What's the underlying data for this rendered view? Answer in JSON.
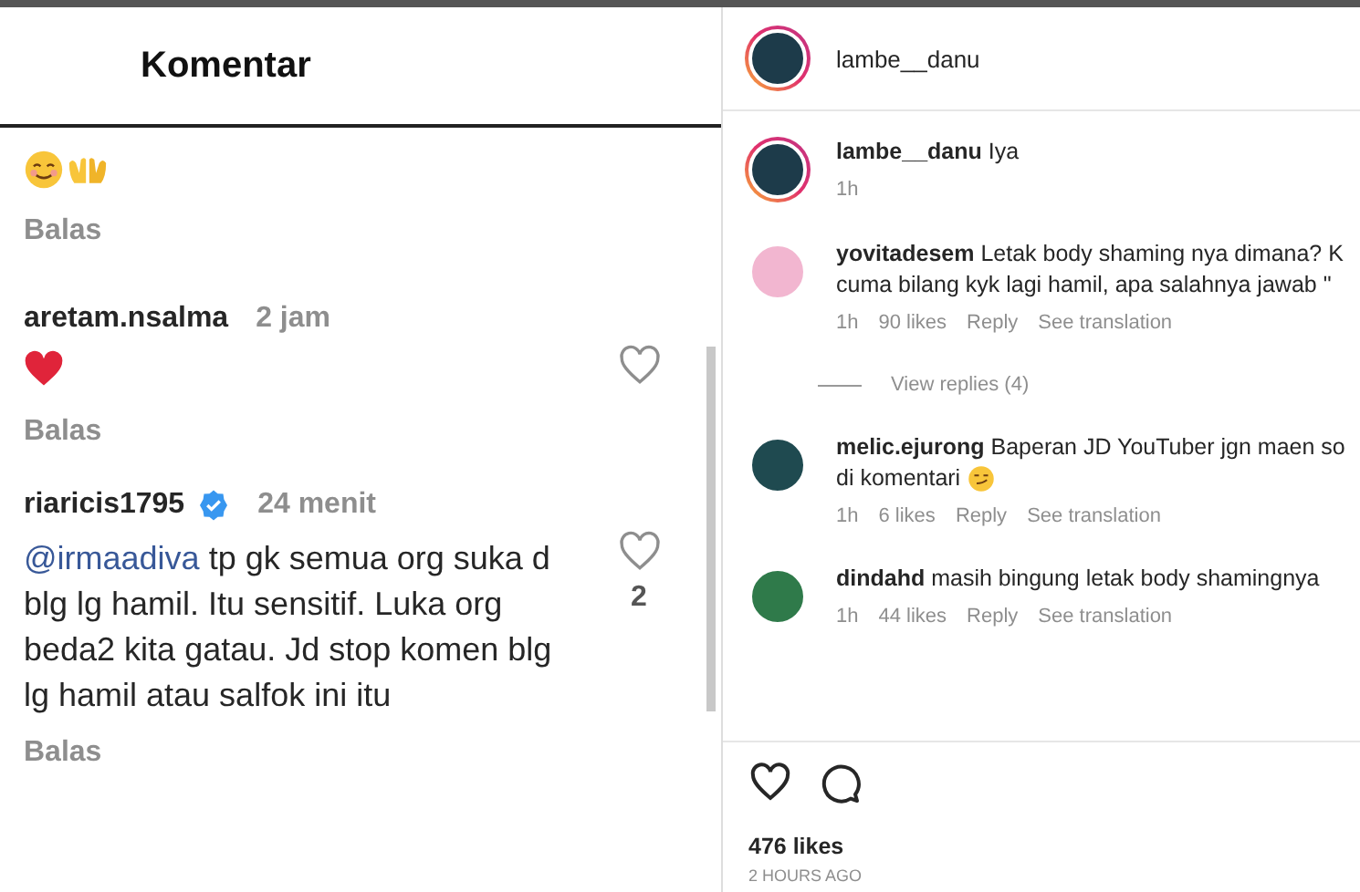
{
  "left": {
    "title": "Komentar",
    "comments": [
      {
        "kind": "partial",
        "emojis": [
          {
            "kind": "smiling-face"
          },
          {
            "kind": "open-hands"
          }
        ],
        "reply": "Balas"
      },
      {
        "kind": "full",
        "username": "aretam.nsalma",
        "verified": false,
        "time": "2 jam",
        "emojis": [
          {
            "kind": "red-heart"
          }
        ],
        "reply": "Balas"
      },
      {
        "kind": "full",
        "username": "riaricis1795",
        "verified": true,
        "time": "24 menit",
        "mention": "@irmaadiva",
        "text": "tp gk semua org suka d blg lg hamil. Itu sensitif. Luka org beda2 kita gatau. Jd stop komen blg lg hamil atau salfok ini itu",
        "like_count": "2",
        "reply": "Balas"
      }
    ]
  },
  "right": {
    "account": {
      "username": "lambe__danu",
      "story_ring": true,
      "color": "#1d3b4a"
    },
    "comments": [
      {
        "username": "lambe__danu",
        "story_ring": true,
        "color": "#1d3b4a",
        "lines": [
          "Iya"
        ],
        "time": "1h"
      },
      {
        "username": "yovitadesem",
        "story_ring": false,
        "color": "#f2b6d0",
        "lines": [
          "Letak body shaming nya dimana? K",
          "cuma bilang kyk lagi hamil, apa salahnya jawab \""
        ],
        "time": "1h",
        "likes": "90 likes",
        "reply": "Reply",
        "translate": "See translation",
        "view_replies": "View replies (4)"
      },
      {
        "username": "melic.ejurong",
        "story_ring": false,
        "color": "#1f4a50",
        "lines": [
          "Baperan JD YouTuber jgn maen so",
          "di komentari"
        ],
        "emoji": {
          "kind": "smirking-face"
        },
        "time": "1h",
        "likes": "6 likes",
        "reply": "Reply",
        "translate": "See translation"
      },
      {
        "username": "dindahd",
        "story_ring": false,
        "color": "#2f7a4a",
        "lines": [
          "masih bingung letak body shamingnya"
        ],
        "time": "1h",
        "likes": "44 likes",
        "reply": "Reply",
        "translate": "See translation"
      }
    ],
    "footer": {
      "likes": "476 likes",
      "time": "2 HOURS AGO"
    }
  }
}
